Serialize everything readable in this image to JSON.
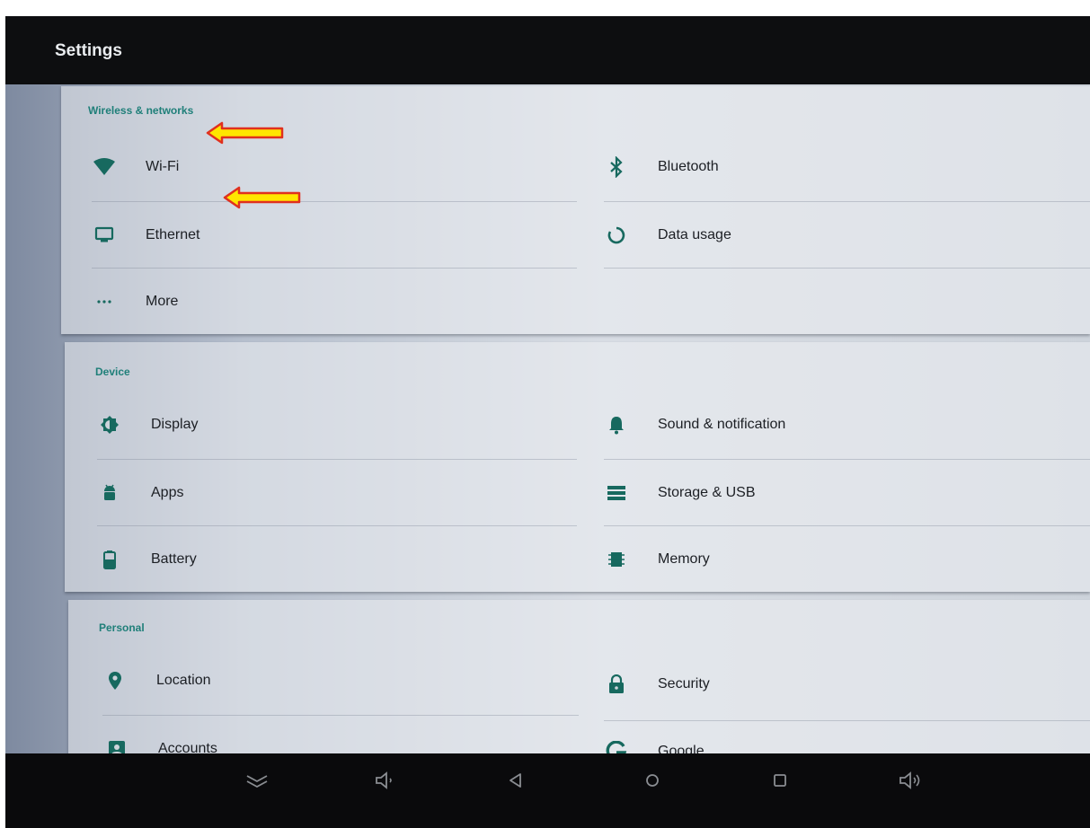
{
  "caption": "",
  "actionbar": {
    "title": "Settings"
  },
  "sections": {
    "wireless": {
      "header": "Wireless & networks",
      "items": {
        "wifi": {
          "label": "Wi-Fi",
          "icon": "wifi-icon"
        },
        "bluetooth": {
          "label": "Bluetooth",
          "icon": "bluetooth-icon"
        },
        "ethernet": {
          "label": "Ethernet",
          "icon": "ethernet-icon"
        },
        "data_usage": {
          "label": "Data usage",
          "icon": "data-usage-icon"
        },
        "more": {
          "label": "More",
          "icon": "more-icon"
        }
      }
    },
    "device": {
      "header": "Device",
      "items": {
        "display": {
          "label": "Display",
          "icon": "brightness-icon"
        },
        "sound": {
          "label": "Sound & notification",
          "icon": "bell-icon"
        },
        "apps": {
          "label": "Apps",
          "icon": "android-icon"
        },
        "storage": {
          "label": "Storage & USB",
          "icon": "storage-icon"
        },
        "battery": {
          "label": "Battery",
          "icon": "battery-icon"
        },
        "memory": {
          "label": "Memory",
          "icon": "memory-icon"
        }
      }
    },
    "personal": {
      "header": "Personal",
      "items": {
        "location": {
          "label": "Location",
          "icon": "location-icon"
        },
        "security": {
          "label": "Security",
          "icon": "lock-icon"
        },
        "accounts": {
          "label": "Accounts",
          "icon": "account-icon"
        },
        "google": {
          "label": "Google",
          "icon": "google-icon"
        }
      }
    }
  },
  "navbar": [
    "hide-keyboard-icon",
    "volume-down-icon",
    "back-icon",
    "home-icon",
    "recents-icon",
    "volume-up-icon"
  ],
  "colors": {
    "accent": "#1f7f79",
    "icon": "#17695f",
    "arrow_fill": "#ffe600",
    "arrow_stroke": "#e0301e"
  }
}
